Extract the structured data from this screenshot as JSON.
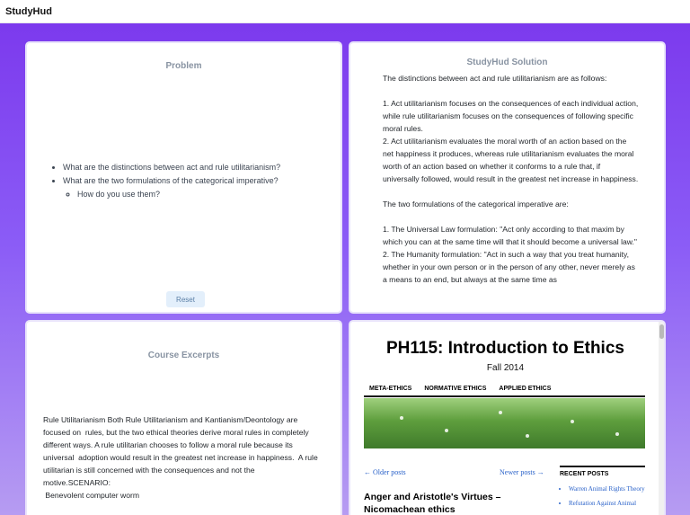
{
  "app": {
    "brand": "StudyHud"
  },
  "problem": {
    "title": "Problem",
    "questions": [
      "What are the distinctions between act and rule utilitarianism?",
      "What are the two formulations of the categorical imperative?"
    ],
    "sub_question": "How do you use them?",
    "reset_label": "Reset"
  },
  "solution": {
    "title": "StudyHud Solution",
    "intro": "The distinctions between act and rule utilitarianism are as follows:",
    "point1": "1. Act utilitarianism focuses on the consequences of each individual action, while rule utilitarianism focuses on the consequences of following specific moral rules.",
    "point2": "2. Act utilitarianism evaluates the moral worth of an action based on the net happiness it produces, whereas rule utilitarianism evaluates the moral worth of an action based on whether it conforms to a rule that, if universally followed, would result in the greatest net increase in happiness.",
    "intro2": "The two formulations of the categorical imperative are:",
    "form1": "1. The Universal Law formulation: \"Act only according to that maxim by which you can at the same time will that it should become a universal law.\"",
    "form2": "2. The Humanity formulation: \"Act in such a way that you treat humanity, whether in your own person or in the person of any other, never merely as a means to an end, but always at the same time as"
  },
  "excerpts": {
    "title": "Course Excerpts",
    "text": "Rule Utilitarianism Both Rule Utilitarianism and Kantianism/Deontology are focused on  rules, but the two ethical theories derive moral rules in completely  different ways. A rule utilitarian chooses to follow a moral rule because its universal  adoption would result in the greatest net increase in happiness.  A rule utilitarian is still concerned with the consequences and not the  motive.SCENARIO:\n Benevolent computer worm"
  },
  "browser": {
    "site_title": "PH115: Introduction to Ethics",
    "site_subtitle": "Fall 2014",
    "nav": [
      "META-ETHICS",
      "NORMATIVE ETHICS",
      "APPLIED ETHICS"
    ],
    "older_posts": "← Older posts",
    "newer_posts": "Newer posts →",
    "post_title": "Anger and Aristotle's Virtues – Nicomachean ethics",
    "recent_heading": "RECENT POSTS",
    "recent_posts": [
      "Warren Animal Rights Theory",
      "Refutation Against Animal"
    ]
  }
}
